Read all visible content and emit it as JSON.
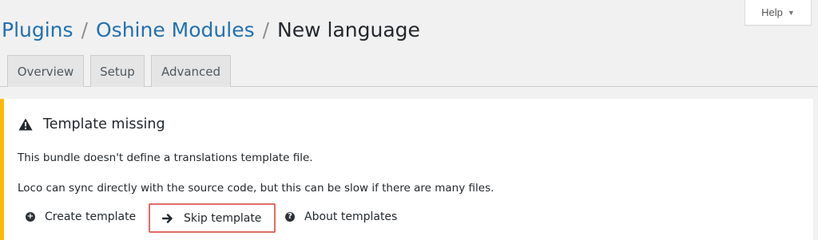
{
  "help": {
    "label": "Help",
    "caret": "▼"
  },
  "breadcrumb": {
    "plugins": "Plugins",
    "module": "Oshine Modules",
    "current": "New language",
    "separator": "/"
  },
  "tabs": [
    {
      "label": "Overview"
    },
    {
      "label": "Setup"
    },
    {
      "label": "Advanced"
    }
  ],
  "notice": {
    "accent_color": "#ffb900",
    "icon": "warning-icon",
    "title": "Template missing",
    "paragraph1": "This bundle doesn't define a translations template file.",
    "paragraph2": "Loco can sync directly with the source code, but this can be slow if there are many files.",
    "actions": {
      "create": {
        "label": "Create template",
        "icon": "plus-circle-icon"
      },
      "skip": {
        "label": "Skip template",
        "icon": "arrow-right-icon",
        "highlight_color": "#e06a66"
      },
      "about": {
        "label": "About templates",
        "icon": "help-circle-icon"
      }
    }
  }
}
